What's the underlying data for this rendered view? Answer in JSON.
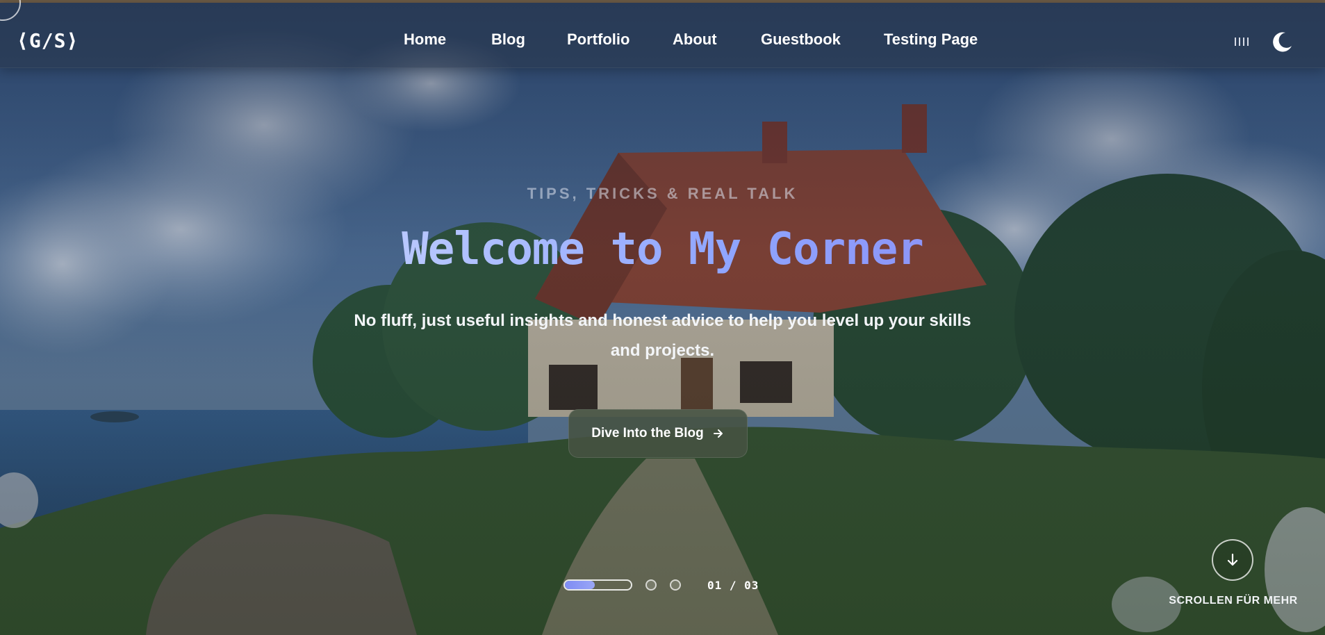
{
  "nav": {
    "logo": "⟨G/S⟩",
    "links": [
      "Home",
      "Blog",
      "Portfolio",
      "About",
      "Guestbook",
      "Testing Page"
    ],
    "menu_icon": "vertical-bars-icon",
    "theme_icon": "moon-icon"
  },
  "hero": {
    "eyebrow": "TIPS, TRICKS & REAL TALK",
    "title": "Welcome to My Corner",
    "subtitle": "No fluff, just useful insights and honest advice to help you level up your skills and projects.",
    "cta_label": "Dive Into the Blog",
    "cta_icon": "arrow-right-icon"
  },
  "slider": {
    "current_progress": 0.45,
    "counter": "01 / 03",
    "dots": 2
  },
  "scroll": {
    "icon": "arrow-down-icon",
    "label": "SCROLLEN FÜR MEHR"
  },
  "colors": {
    "accent": "#8fa5ff",
    "cta_bg": "#465242"
  }
}
